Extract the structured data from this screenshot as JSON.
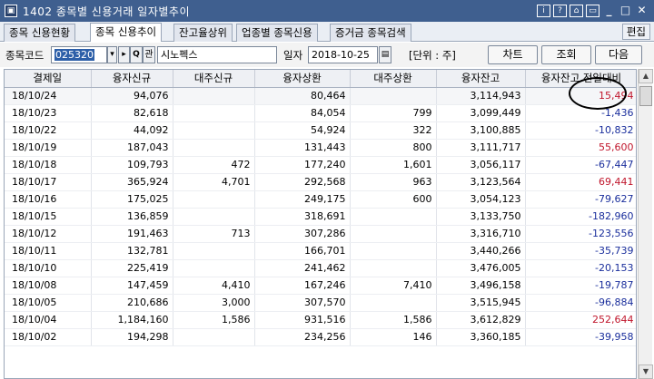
{
  "window": {
    "screen_no": "1402",
    "title": "종목별 신용거래 일자별추이",
    "buttons": [
      "i",
      "?",
      "⌂",
      "▭",
      "_",
      "□",
      "✕"
    ]
  },
  "tabs": [
    {
      "label": "종목 신용현황",
      "active": false
    },
    {
      "label": "종목 신용추이",
      "active": true
    },
    {
      "label": "잔고율상위",
      "active": false
    },
    {
      "label": "업종별 종목신용",
      "active": false
    },
    {
      "label": "증거금 종목검색",
      "active": false
    }
  ],
  "edit_label": "편집",
  "search": {
    "code_label": "종목코드",
    "code_value": "025320",
    "name_value": "시노펙스",
    "date_label": "일자",
    "date_value": "2018-10-25",
    "unit_text": "[단위 : 주]",
    "chart_btn": "차트",
    "query_btn": "조회",
    "next_btn": "다음",
    "quote_btn": "관",
    "search_icon_glyph": "Q",
    "arrow_glyph": "▸",
    "dropdown_glyph": "▾",
    "calendar_glyph": "▤"
  },
  "table": {
    "headers": [
      "결제일",
      "융자신규",
      "대주신규",
      "융자상환",
      "대주상환",
      "융자잔고",
      "융자잔고 전일대비"
    ],
    "rows": [
      [
        "18/10/24",
        "94,076",
        "",
        "80,464",
        "",
        "3,114,943",
        "15,494"
      ],
      [
        "18/10/23",
        "82,618",
        "",
        "84,054",
        "799",
        "3,099,449",
        "-1,436"
      ],
      [
        "18/10/22",
        "44,092",
        "",
        "54,924",
        "322",
        "3,100,885",
        "-10,832"
      ],
      [
        "18/10/19",
        "187,043",
        "",
        "131,443",
        "800",
        "3,111,717",
        "55,600"
      ],
      [
        "18/10/18",
        "109,793",
        "472",
        "177,240",
        "1,601",
        "3,056,117",
        "-67,447"
      ],
      [
        "18/10/17",
        "365,924",
        "4,701",
        "292,568",
        "963",
        "3,123,564",
        "69,441"
      ],
      [
        "18/10/16",
        "175,025",
        "",
        "249,175",
        "600",
        "3,054,123",
        "-79,627"
      ],
      [
        "18/10/15",
        "136,859",
        "",
        "318,691",
        "",
        "3,133,750",
        "-182,960"
      ],
      [
        "18/10/12",
        "191,463",
        "713",
        "307,286",
        "",
        "3,316,710",
        "-123,556"
      ],
      [
        "18/10/11",
        "132,781",
        "",
        "166,701",
        "",
        "3,440,266",
        "-35,739"
      ],
      [
        "18/10/10",
        "225,419",
        "",
        "241,462",
        "",
        "3,476,005",
        "-20,153"
      ],
      [
        "18/10/08",
        "147,459",
        "4,410",
        "167,246",
        "7,410",
        "3,496,158",
        "-19,787"
      ],
      [
        "18/10/05",
        "210,686",
        "3,000",
        "307,570",
        "",
        "3,515,945",
        "-96,884"
      ],
      [
        "18/10/04",
        "1,184,160",
        "1,586",
        "931,516",
        "1,586",
        "3,612,829",
        "252,644"
      ],
      [
        "18/10/02",
        "194,298",
        "",
        "234,256",
        "146",
        "3,360,185",
        "-39,958"
      ]
    ]
  },
  "colors": {
    "titlebar": "#3f5f8f",
    "positive": "#c0162c",
    "negative": "#1a2e9c"
  }
}
